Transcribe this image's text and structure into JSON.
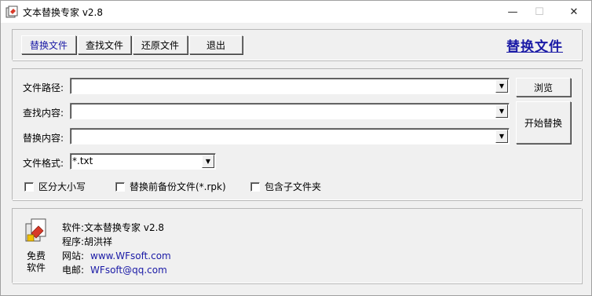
{
  "window": {
    "title": "文本替换专家 v2.8",
    "minimize_glyph": "—",
    "maximize_glyph": "☐",
    "close_glyph": "✕"
  },
  "toolbar": {
    "tabs": [
      {
        "label": "替换文件",
        "active": true
      },
      {
        "label": "查找文件",
        "active": false
      },
      {
        "label": "还原文件",
        "active": false
      },
      {
        "label": "退出",
        "active": false
      }
    ],
    "header_link": "替换文件"
  },
  "form": {
    "path_label": "文件路径:",
    "path_value": "",
    "find_label": "查找内容:",
    "find_value": "",
    "replace_label": "替换内容:",
    "replace_value": "",
    "format_label": "文件格式:",
    "format_value": "*.txt",
    "browse_button": "浏览",
    "start_button": "开始替换",
    "dropdown_glyph": "▼"
  },
  "options": {
    "case_sensitive": {
      "label": "区分大小写",
      "checked": false
    },
    "backup": {
      "label": "替换前备份文件(*.rpk)",
      "checked": false
    },
    "subfolders": {
      "label": "包含子文件夹",
      "checked": false
    }
  },
  "info": {
    "free_label_line1": "免费",
    "free_label_line2": "软件",
    "software_line": "软件:文本替换专家 v2.8",
    "author_line": "程序:胡洪祥",
    "website_label": "网站:",
    "website_value": "www.WFsoft.com",
    "email_label": "电邮:",
    "email_value": "WFsoft@qq.com"
  },
  "colors": {
    "accent": "#1a1aa6",
    "window_bg": "#f0f0f0"
  }
}
